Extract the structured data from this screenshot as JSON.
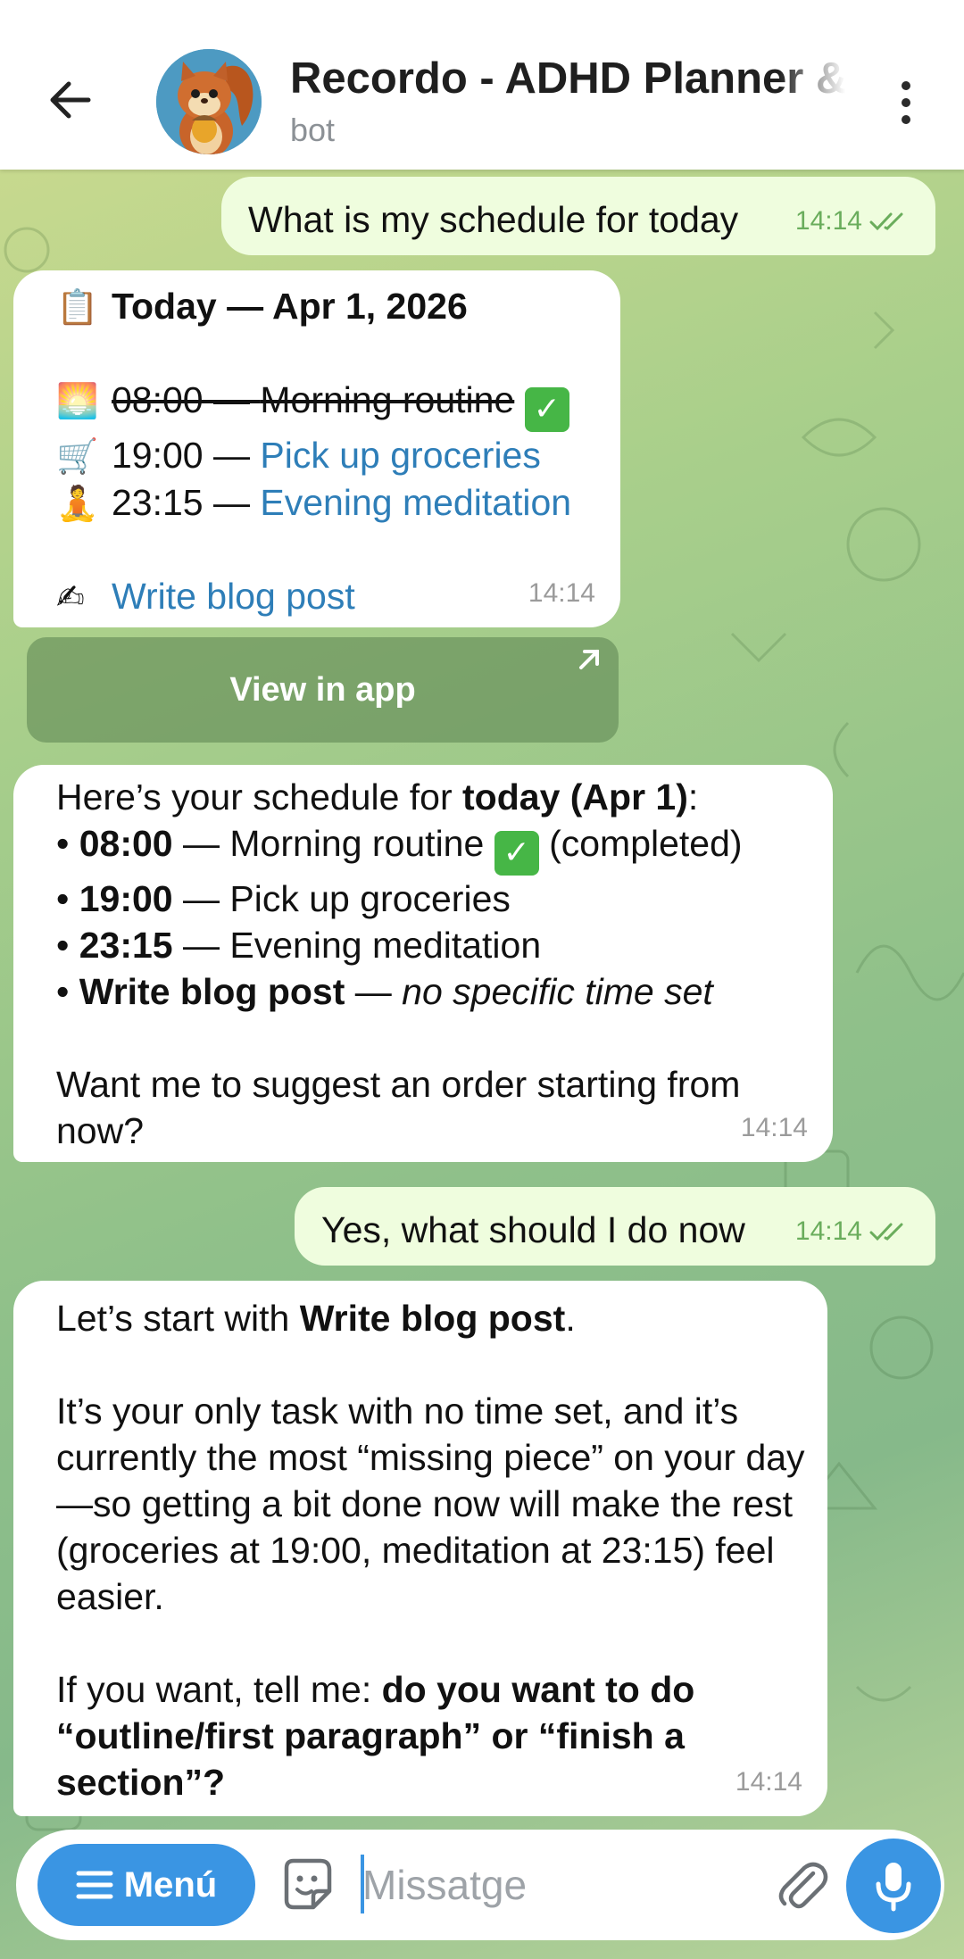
{
  "header": {
    "title": "Recordo - ADHD Planner & Notes",
    "subtitle": "bot"
  },
  "messages": {
    "m1": {
      "text": "What is my schedule for today",
      "time": "14:14"
    },
    "m2": {
      "heading_emoji": "📋",
      "heading": "Today — Apr 1, 2026",
      "items": [
        {
          "emoji": "🌅",
          "time": "08:00 — ",
          "task": "Morning routine",
          "done": "✅"
        },
        {
          "emoji": "🛒",
          "time": "19:00 — ",
          "task": "Pick up groceries"
        },
        {
          "emoji": "🧘",
          "time": "23:15 — ",
          "task": "Evening meditation"
        }
      ],
      "untimed_emoji": "✍",
      "untimed": "Write blog post",
      "time": "14:14",
      "button": "View in app"
    },
    "m3": {
      "intro_a": "Here’s your schedule for ",
      "intro_b": "today (Apr 1)",
      "intro_c": ":",
      "l1_time": "08:00",
      "l1_rest": " — Morning routine ",
      "l1_done": "✅",
      "l1_tail": " (completed)",
      "l2_time": "19:00",
      "l2_rest": " — Pick up groceries",
      "l3_time": "23:15",
      "l3_rest": " — Evening meditation",
      "l4_task": "Write blog post",
      "l4_dash": " — ",
      "l4_note": "no specific time set",
      "question": "Want me to suggest an order starting from now?",
      "time": "14:14"
    },
    "m4": {
      "text": "Yes, what should I do now",
      "time": "14:14"
    },
    "m5": {
      "p1_a": "Let’s start with ",
      "p1_b": "Write blog post",
      "p1_c": ".",
      "p2": "It’s your only task with no time set, and it’s currently the most “missing piece” on your day—so getting a bit done now will make the rest (groceries at 19:00, meditation at 23:15) feel easier.",
      "p3_a": "If you want, tell me: ",
      "p3_b": "do you want to do “outline/first paragraph” or “finish a section”?",
      "time": "14:14"
    }
  },
  "input": {
    "menu_label": "Menú",
    "placeholder": "Missatge"
  },
  "colors": {
    "accent": "#3a95e3",
    "link": "#2e7eb8",
    "outgoing_bubble": "#effdde",
    "read_ticks": "#6aad5c"
  }
}
